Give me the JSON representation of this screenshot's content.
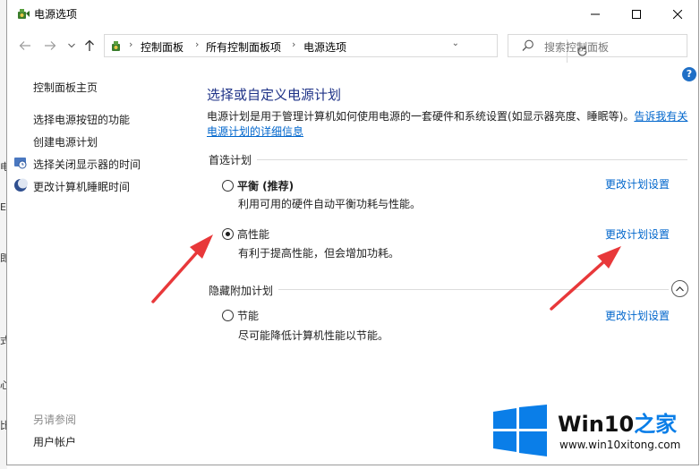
{
  "window": {
    "title": "电源选项"
  },
  "background": {
    "glyphs": [
      "电",
      "E",
      "即",
      "式",
      "心",
      "比"
    ]
  },
  "nav": {
    "breadcrumbs": [
      "控制面板",
      "所有控制面板项",
      "电源选项"
    ],
    "search_placeholder": "搜索控制面板"
  },
  "sidebar": {
    "home": "控制面板主页",
    "items": [
      {
        "label": "选择电源按钮的功能"
      },
      {
        "label": "创建电源计划"
      },
      {
        "label": "选择关闭显示器的时间"
      },
      {
        "label": "更改计算机睡眠时间"
      }
    ],
    "see_also_title": "另请参阅",
    "see_also_items": [
      "用户帐户"
    ]
  },
  "main": {
    "title": "选择或自定义电源计划",
    "description": "电源计划是用于管理计算机如何使用电源的一套硬件和系统设置(如显示器亮度、睡眠等)。",
    "description_link": "告诉我有关电源计划的详细信息",
    "preferred_title": "首选计划",
    "hidden_title": "隐藏附加计划",
    "plans": [
      {
        "name": "平衡 (推荐)",
        "desc": "利用可用的硬件自动平衡功耗与性能。",
        "link": "更改计划设置",
        "selected": false
      },
      {
        "name": "高性能",
        "desc": "有利于提高性能，但会增加功耗。",
        "link": "更改计划设置",
        "selected": true
      },
      {
        "name": "节能",
        "desc": "尽可能降低计算机性能以节能。",
        "link": "更改计划设置",
        "selected": false
      }
    ]
  },
  "watermark": {
    "brand": "Win10",
    "brand_suffix": "之家",
    "url": "www.win10xitong.com"
  },
  "colors": {
    "accent": "#0a7ee8",
    "link": "#0066cc",
    "title": "#1e3287",
    "arrow": "#e8383a"
  }
}
